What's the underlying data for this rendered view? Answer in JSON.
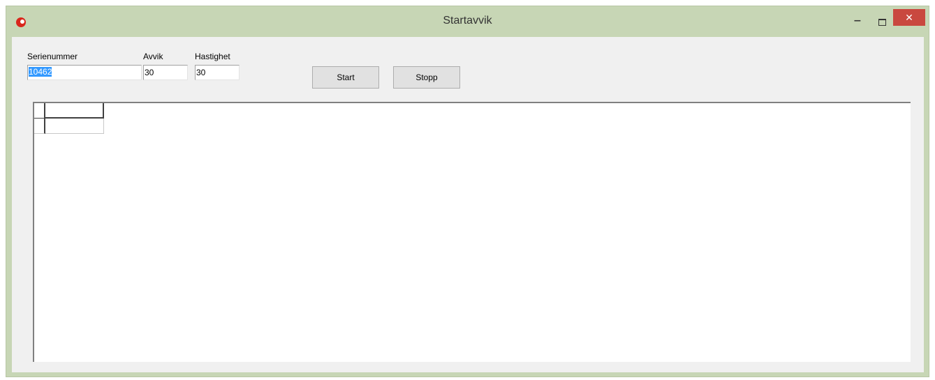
{
  "window": {
    "title": "Startavvik",
    "minimize_label": "‒",
    "close_label": "✕"
  },
  "form": {
    "serial": {
      "label": "Serienummer",
      "value": "10462"
    },
    "avvik": {
      "label": "Avvik",
      "value": "30"
    },
    "hastighet": {
      "label": "Hastighet",
      "value": "30"
    },
    "start_label": "Start",
    "stop_label": "Stopp"
  },
  "grid": {
    "rows": [
      [
        "",
        ""
      ],
      [
        "",
        ""
      ]
    ]
  }
}
